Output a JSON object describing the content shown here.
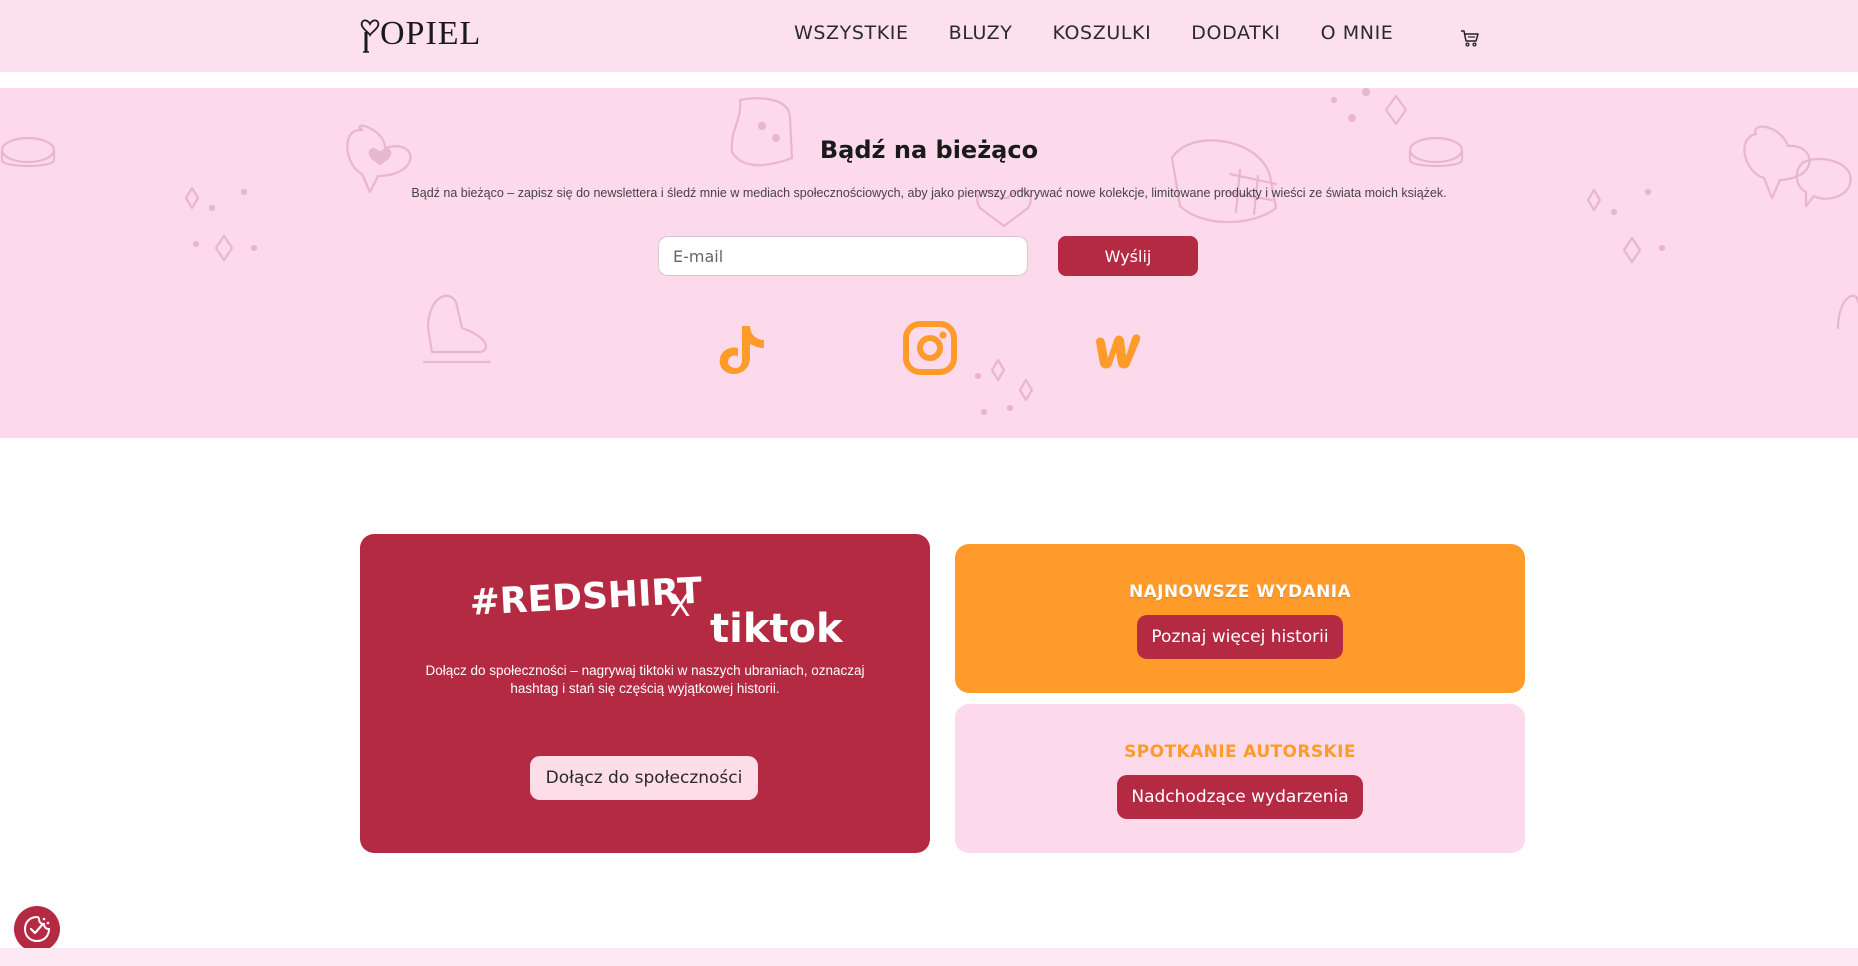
{
  "header": {
    "logo_text": "OPIEL",
    "nav": [
      "WSZYSTKIE",
      "BLUZY",
      "KOSZULKI",
      "DODATKI",
      "O MNIE"
    ],
    "cart_icon": "cart-icon"
  },
  "newsletter": {
    "title": "Bądź na bieżąco",
    "description": "Bądź na bieżąco – zapisz się do newslettera i śledź mnie w mediach społecznościowych, aby jako pierwszy odkrywać nowe kolekcje, limitowane produkty i wieści ze świata moich książek.",
    "email_placeholder": "E-mail",
    "submit_label": "Wyślij",
    "social": [
      "tiktok-icon",
      "instagram-icon",
      "wattpad-icon"
    ]
  },
  "cards": {
    "community": {
      "brand_left": "#REDSHIRT",
      "brand_x": "X",
      "brand_right": "tiktok",
      "description": "Dołącz do społeczności – nagrywaj tiktoki w naszych ubraniach, oznaczaj hashtag i stań się częścią wyjątkowej historii.",
      "button": "Dołącz do społeczności"
    },
    "releases": {
      "heading": "NAJNOWSZE WYDANIA",
      "button": "Poznaj więcej historii"
    },
    "meeting": {
      "heading": "SPOTKANIE AUTORSKIE",
      "button": "Nadchodzące wydarzenia"
    }
  },
  "colors": {
    "primary_red": "#b42a42",
    "pink_bg": "#fcd9eb",
    "header_bg": "#fce0ee",
    "orange": "#ff9b2a"
  },
  "cookie_icon": "cookie-consent-icon"
}
